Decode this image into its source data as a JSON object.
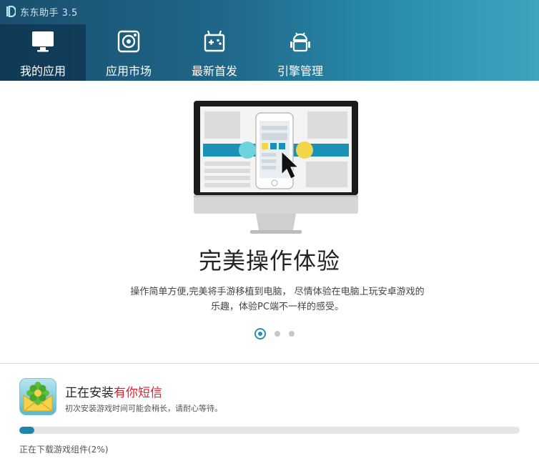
{
  "window": {
    "title": "东东助手 3.5"
  },
  "tabs": [
    {
      "label": "我的应用",
      "icon": "monitor-icon",
      "active": true
    },
    {
      "label": "应用市场",
      "icon": "app-market-icon",
      "active": false
    },
    {
      "label": "最新首发",
      "icon": "gamepad-icon",
      "active": false
    },
    {
      "label": "引擎管理",
      "icon": "android-icon",
      "active": false
    }
  ],
  "hero": {
    "title": "完美操作体验",
    "desc_line1": "操作简单方便,完美将手游移植到电脑， 尽情体验在电脑上玩安卓游戏的",
    "desc_line2": "乐趣，体验PC端不一样的感受。",
    "slide_count": 3,
    "active_slide": 1
  },
  "install": {
    "prefix": "正在安装",
    "app_name": "有你短信",
    "hint": "初次安装游戏时间可能会稍长，请耐心等待。",
    "progress": 0.02,
    "status": "正在下载游戏组件(2%)",
    "progress_color": "#1f86aa",
    "app_name_color": "#e0202a"
  }
}
